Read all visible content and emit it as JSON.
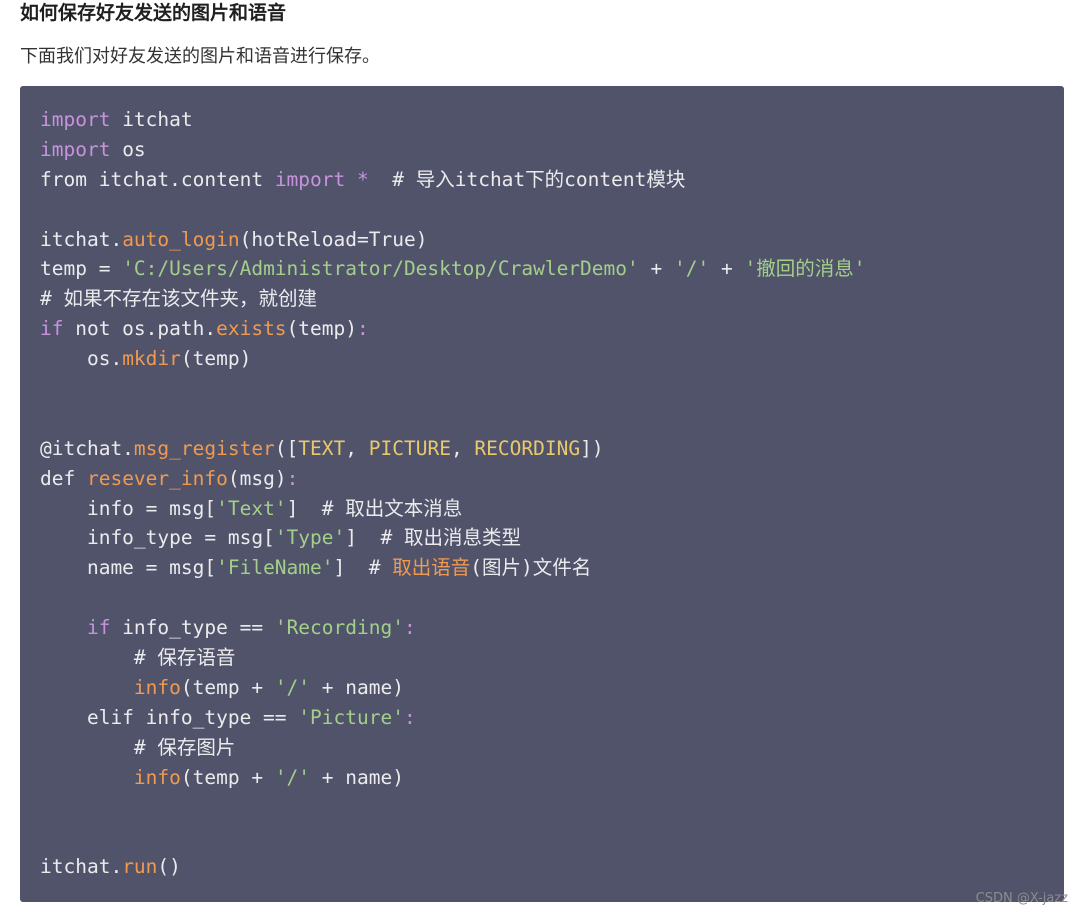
{
  "heading": "如何保存好友发送的图片和语音",
  "intro": "下面我们对好友发送的图片和语音进行保存。",
  "watermark": "CSDN @X-jazz",
  "colors": {
    "code_background": "#50536a",
    "keyword": "#c793dc",
    "function": "#f09a50",
    "string": "#a3cf8a",
    "constant": "#e8c96d",
    "default": "#ebebee"
  },
  "code_lines": [
    [
      [
        "keyword",
        "import"
      ],
      [
        "default",
        " itchat"
      ]
    ],
    [
      [
        "keyword",
        "import"
      ],
      [
        "default",
        " os"
      ]
    ],
    [
      [
        "default",
        "from itchat.content "
      ],
      [
        "keyword",
        "import"
      ],
      [
        "default",
        " "
      ],
      [
        "keyword",
        "*"
      ],
      [
        "comment",
        "  # 导入itchat下的content模块"
      ]
    ],
    [],
    [
      [
        "default",
        "itchat."
      ],
      [
        "function",
        "auto_login"
      ],
      [
        "default",
        "(hotReload=True)"
      ]
    ],
    [
      [
        "default",
        "temp = "
      ],
      [
        "string",
        "'C:/Users/Administrator/Desktop/CrawlerDemo'"
      ],
      [
        "default",
        " + "
      ],
      [
        "string",
        "'/'"
      ],
      [
        "default",
        " + "
      ],
      [
        "string",
        "'撤回的消息'"
      ]
    ],
    [
      [
        "comment",
        "# 如果不存在该文件夹，就创建"
      ]
    ],
    [
      [
        "keyword",
        "if"
      ],
      [
        "default",
        " not os.path."
      ],
      [
        "function",
        "exists"
      ],
      [
        "default",
        "(temp)"
      ],
      [
        "keyword",
        ":"
      ]
    ],
    [
      [
        "default",
        "    os."
      ],
      [
        "function",
        "mkdir"
      ],
      [
        "default",
        "(temp)"
      ]
    ],
    [],
    [],
    [
      [
        "default",
        "@itchat."
      ],
      [
        "function",
        "msg_register"
      ],
      [
        "default",
        "(["
      ],
      [
        "constant",
        "TEXT"
      ],
      [
        "default",
        ", "
      ],
      [
        "constant",
        "PICTURE"
      ],
      [
        "default",
        ", "
      ],
      [
        "constant",
        "RECORDING"
      ],
      [
        "default",
        "])"
      ]
    ],
    [
      [
        "default",
        "def "
      ],
      [
        "function",
        "resever_info"
      ],
      [
        "default",
        "(msg)"
      ],
      [
        "keyword",
        ":"
      ]
    ],
    [
      [
        "default",
        "    info = msg["
      ],
      [
        "string",
        "'Text'"
      ],
      [
        "default",
        "]"
      ],
      [
        "comment",
        "  # 取出文本消息"
      ]
    ],
    [
      [
        "default",
        "    info_type = msg["
      ],
      [
        "string",
        "'Type'"
      ],
      [
        "default",
        "]"
      ],
      [
        "comment",
        "  # 取出消息类型"
      ]
    ],
    [
      [
        "default",
        "    name = msg["
      ],
      [
        "string",
        "'FileName'"
      ],
      [
        "default",
        "]"
      ],
      [
        "comment",
        "  # "
      ],
      [
        "function",
        "取出语音"
      ],
      [
        "comment",
        "(图片)文件名"
      ]
    ],
    [],
    [
      [
        "keyword",
        "    if"
      ],
      [
        "default",
        " info_type == "
      ],
      [
        "string",
        "'Recording'"
      ],
      [
        "keyword",
        ":"
      ]
    ],
    [
      [
        "comment",
        "        # 保存语音"
      ]
    ],
    [
      [
        "default",
        "        "
      ],
      [
        "function",
        "info"
      ],
      [
        "default",
        "(temp + "
      ],
      [
        "string",
        "'/'"
      ],
      [
        "default",
        " + name)"
      ]
    ],
    [
      [
        "default",
        "    elif info_type == "
      ],
      [
        "string",
        "'Picture'"
      ],
      [
        "keyword",
        ":"
      ]
    ],
    [
      [
        "comment",
        "        # 保存图片"
      ]
    ],
    [
      [
        "default",
        "        "
      ],
      [
        "function",
        "info"
      ],
      [
        "default",
        "(temp + "
      ],
      [
        "string",
        "'/'"
      ],
      [
        "default",
        " + name)"
      ]
    ],
    [],
    [],
    [
      [
        "default",
        "itchat."
      ],
      [
        "function",
        "run"
      ],
      [
        "default",
        "()"
      ]
    ]
  ]
}
